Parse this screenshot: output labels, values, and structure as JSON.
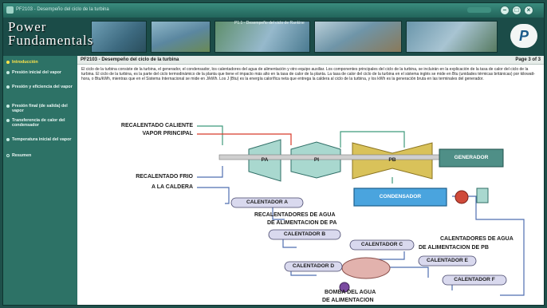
{
  "window": {
    "title": "PF2103 - Desempeño del ciclo de la turbina"
  },
  "banner": {
    "logo_line1": "Power",
    "logo_line2": "Fundamentals",
    "subtitle": "P1.1 - Desempeño del ciclo de Rankine",
    "brand_mark": "P"
  },
  "sidebar": {
    "items": [
      {
        "label": "Introducción"
      },
      {
        "label": "Presión inicial del vapor"
      },
      {
        "label": "Presión y eficiencia del vapor"
      },
      {
        "label": "Presión final (de salida) del vapor"
      },
      {
        "label": "Transferencia de calor del condensador"
      },
      {
        "label": "Temperatura inicial del vapor"
      },
      {
        "label": "Resumen"
      }
    ]
  },
  "content": {
    "title": "PF2103 - Desempeño del ciclo de la turbina",
    "page": "Page 3 of 3",
    "paragraph": "El ciclo de la turbina consiste de la turbina, el generador, el condensador, los calentadores del agua de alimentación y otro equipo auxiliar. Los componentes principales del ciclo de la turbina, se incluirán en la explicación de la tasa de calor del ciclo de la turbina. El ciclo de la turbina, es la parte del ciclo termodinámico de la planta que tiene el impacto más alto en la tasa de calor de la planta. La tasa de calor del ciclo de la turbina en el sistema inglés se mide en Btu (unidades térmicas británicas) por kilowatt-hora, o Btu/kWh, mientras que en el Sistema Internacional se mide en J/kWh. Los J (Btu) es la energía calorífica neta que entrega la caldera al ciclo de la turbina, y los kWh es la generación bruta en las terminales del generador."
  },
  "diagram": {
    "labels": {
      "hot_reheat": "RECALENTADO CALIENTE",
      "main_steam": "VAPOR PRINCIPAL",
      "cold_reheat_1": "RECALENTADO FRIO",
      "cold_reheat_2": "A LA CALDERA",
      "hp": "PA",
      "ip": "PI",
      "lp": "PB",
      "generator": "GENERADOR",
      "condenser": "CONDENSADOR",
      "heater_a": "CALENTADOR A",
      "heater_b": "CALENTADOR B",
      "heater_c": "CALENTADOR C",
      "heater_d": "CALENTADOR D",
      "heater_e": "CALENTADOR E",
      "heater_f": "CALENTADOR F",
      "hp_heaters_1": "RECALENTADORES DE AGUA",
      "hp_heaters_2": "DE ALIMENTACION DE PA",
      "lp_heaters_1": "CALENTADORES DE AGUA",
      "lp_heaters_2": "DE ALIMENTACION DE PB",
      "pump_1": "BOMBA DEL AGUA",
      "pump_2": "DE ALIMENTACION"
    },
    "colors": {
      "turbine_hp_ip": "#a9d8cf",
      "turbine_lp": "#d9c25a",
      "generator": "#4f8f87",
      "condenser": "#4aa4de",
      "heater": "#d9d9ee",
      "hot_line": "#d83a2a",
      "steam_line": "#3f9a7c",
      "water_line": "#4f6fb0",
      "pump": "#cf4a3a"
    }
  }
}
